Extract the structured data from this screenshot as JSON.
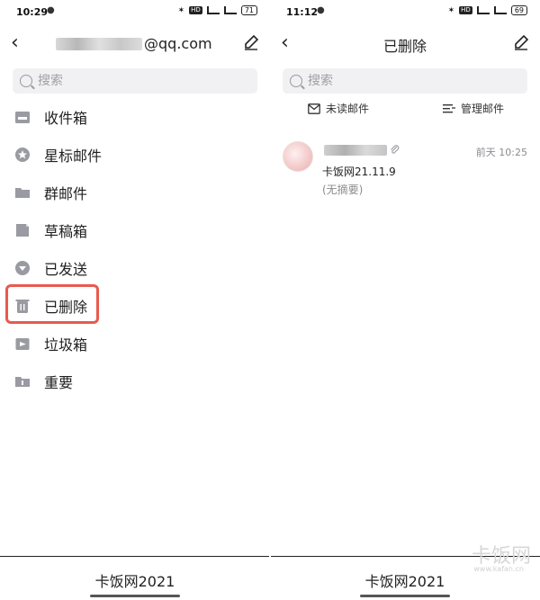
{
  "left": {
    "status": {
      "time": "10:29",
      "battery": "71"
    },
    "nav": {
      "account_suffix": "@qq.com"
    },
    "search": {
      "placeholder": "搜索"
    },
    "folders": [
      {
        "label": "收件箱",
        "icon": "inbox-icon"
      },
      {
        "label": "星标邮件",
        "icon": "star-icon"
      },
      {
        "label": "群邮件",
        "icon": "folder-icon"
      },
      {
        "label": "草稿箱",
        "icon": "draft-icon"
      },
      {
        "label": "已发送",
        "icon": "sent-icon"
      },
      {
        "label": "已删除",
        "icon": "trash-icon"
      },
      {
        "label": "垃圾箱",
        "icon": "spam-icon"
      },
      {
        "label": "重要",
        "icon": "important-icon"
      }
    ]
  },
  "right": {
    "status": {
      "time": "11:12",
      "battery": "69"
    },
    "nav": {
      "title": "已删除"
    },
    "search": {
      "placeholder": "搜索"
    },
    "tools": {
      "unread": "未读邮件",
      "manage": "管理邮件"
    },
    "mail": {
      "time": "前天 10:25",
      "subject": "卡饭网21.11.9",
      "summary": "(无摘要)"
    }
  },
  "bottom": {
    "left_caption": "卡饭网2021",
    "right_caption": "卡饭网2021"
  },
  "watermark": {
    "text": "卡饭网",
    "sub": "www.kafan.cn"
  },
  "colors": {
    "highlight": "#e85a4f",
    "icon": "#9a9aa2",
    "muted": "#8b8b8f"
  }
}
